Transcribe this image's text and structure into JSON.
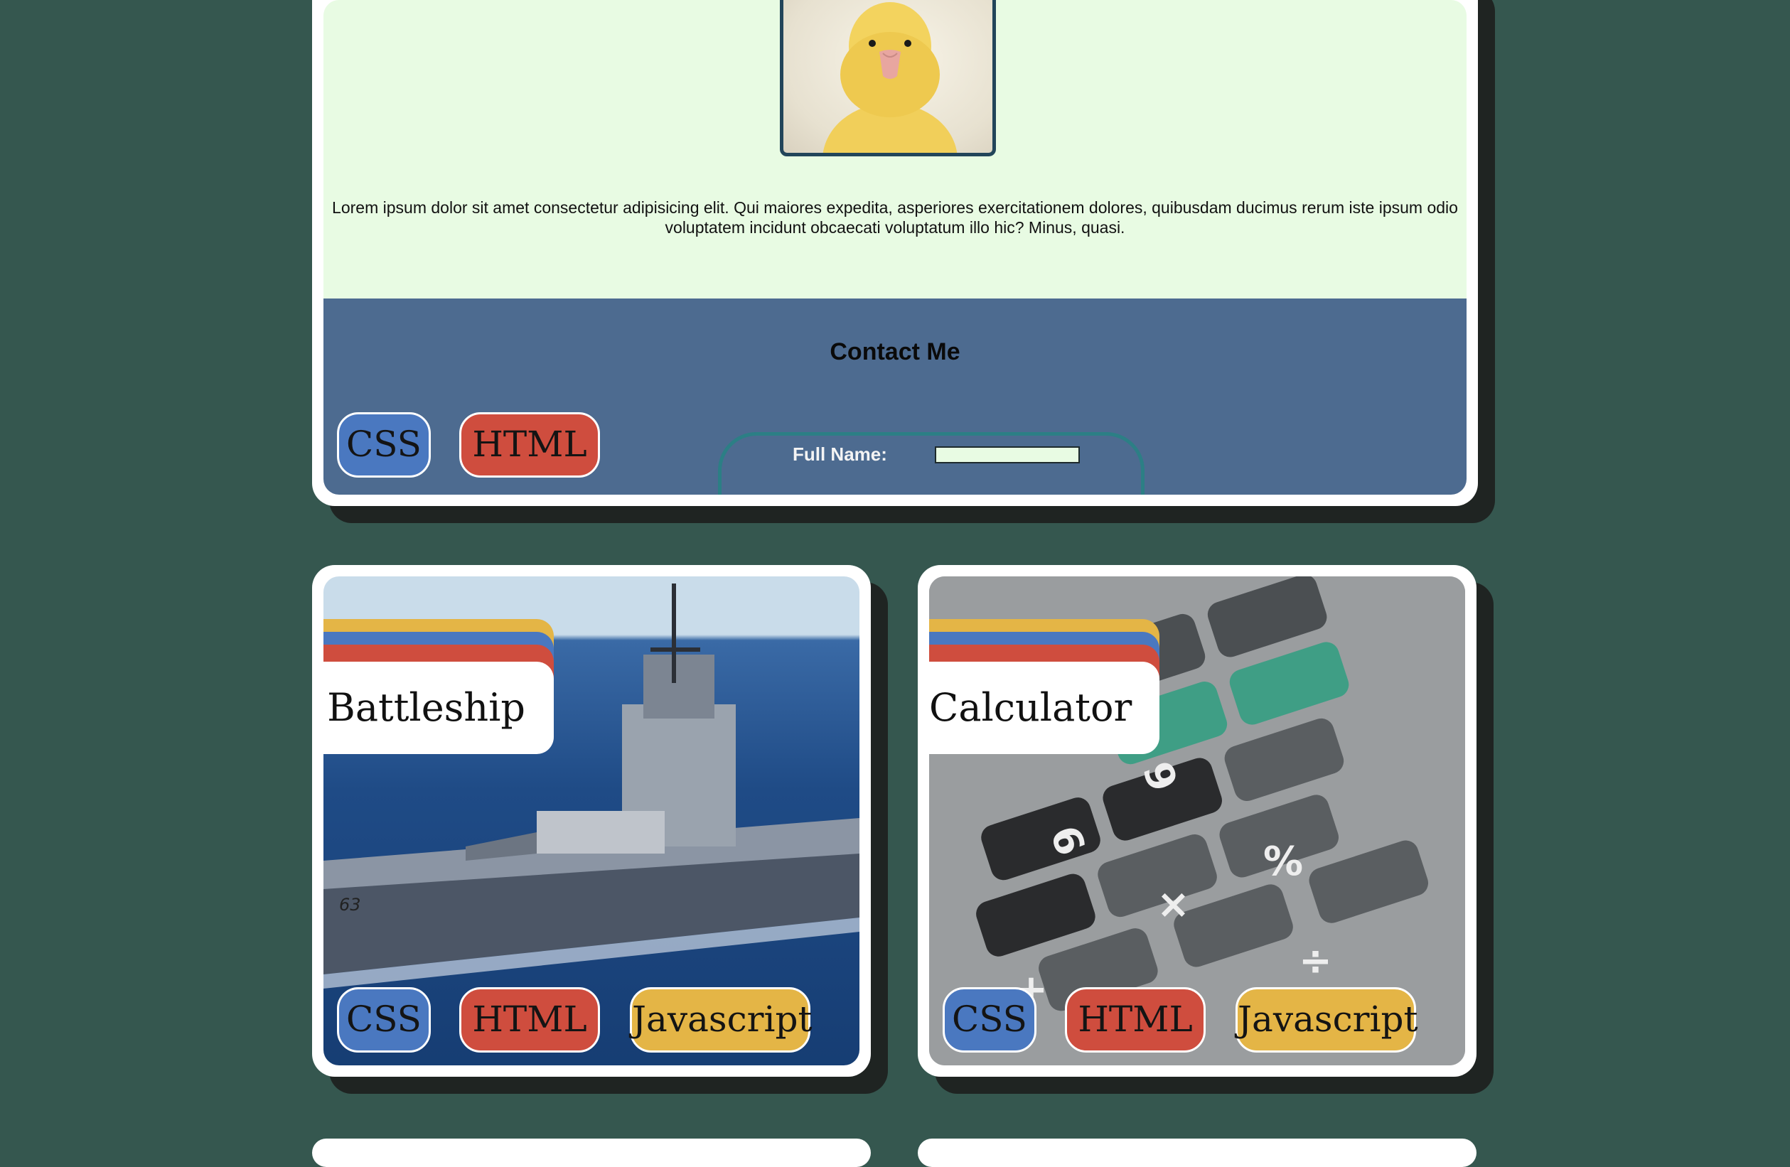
{
  "preview_card": {
    "description_text": "Lorem ipsum dolor sit amet consectetur adipisicing elit. Qui maiores expedita, asperiores exercitationem dolores, quibusdam ducimus rerum iste ipsum odio voluptatem incidunt obcaecati voluptatum illo hic? Minus, quasi.",
    "contact_title": "Contact Me",
    "form": {
      "full_name_label": "Full Name:",
      "full_name_value": ""
    },
    "tags": [
      "CSS",
      "HTML"
    ]
  },
  "projects": [
    {
      "title": "Battleship",
      "tags": [
        "CSS",
        "HTML",
        "Javascript"
      ]
    },
    {
      "title": "Calculator",
      "tags": [
        "CSS",
        "HTML",
        "Javascript"
      ]
    }
  ],
  "colors": {
    "page_background": "#35574f",
    "preview_background": "#e8fbe3",
    "contact_background": "#4d6b90",
    "tag_css": "#4a78c0",
    "tag_html": "#cf4d3e",
    "tag_js": "#e4b546"
  }
}
